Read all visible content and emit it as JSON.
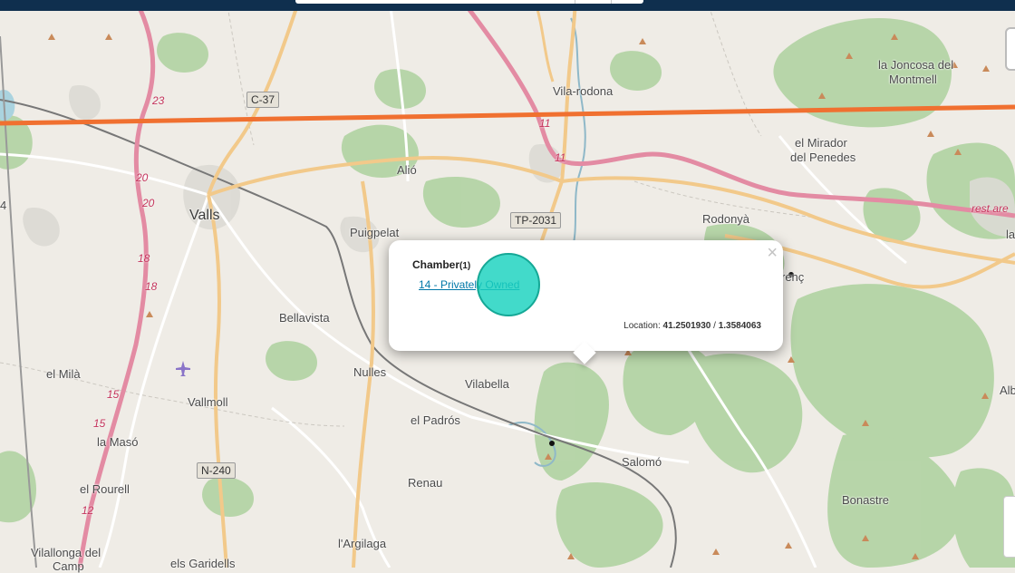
{
  "map": {
    "places": [
      {
        "name": "Vila-rodona"
      },
      {
        "name": "la Joncosa del"
      },
      {
        "name": "Montmell"
      },
      {
        "name": "el Mirador"
      },
      {
        "name": "del Penedes"
      },
      {
        "name": "Alió"
      },
      {
        "name": "Valls"
      },
      {
        "name": "Puigpelat"
      },
      {
        "name": "Rodonyà"
      },
      {
        "name": "Bellavista"
      },
      {
        "name": "Nulles"
      },
      {
        "name": "Vilabella"
      },
      {
        "name": "el Milà"
      },
      {
        "name": "Vallmoll"
      },
      {
        "name": "el Padrós"
      },
      {
        "name": "la Masó"
      },
      {
        "name": "Salomó"
      },
      {
        "name": "Renau"
      },
      {
        "name": "el Rourell"
      },
      {
        "name": "Bonastre"
      },
      {
        "name": "Vilallonga del"
      },
      {
        "name": "Camp"
      },
      {
        "name": "l'Argilaga"
      },
      {
        "name": "els Garidells"
      },
      {
        "name": "Alb"
      },
      {
        "name": "la"
      },
      {
        "name": "renç"
      },
      {
        "name": "4"
      }
    ],
    "road_shields": [
      "C-37",
      "TP-2031",
      "N-240"
    ],
    "road_numbers": [
      "23",
      "20",
      "20",
      "18",
      "18",
      "15",
      "15",
      "12",
      "11",
      "11"
    ],
    "poi_label": "rest are"
  },
  "popup": {
    "title": "Chamber",
    "count": "(1)",
    "link": "14 - Privately Owned",
    "location_label": "Location:",
    "lat": "41.2501930",
    "separator": "/",
    "lon": "1.3584063",
    "close": "×"
  },
  "colors": {
    "topbar": "#0f2f4e",
    "line": "#f07030",
    "motorway": "#e38ba3",
    "primary": "#f2c98a",
    "forest": "#add19e",
    "link": "#0078a8"
  }
}
